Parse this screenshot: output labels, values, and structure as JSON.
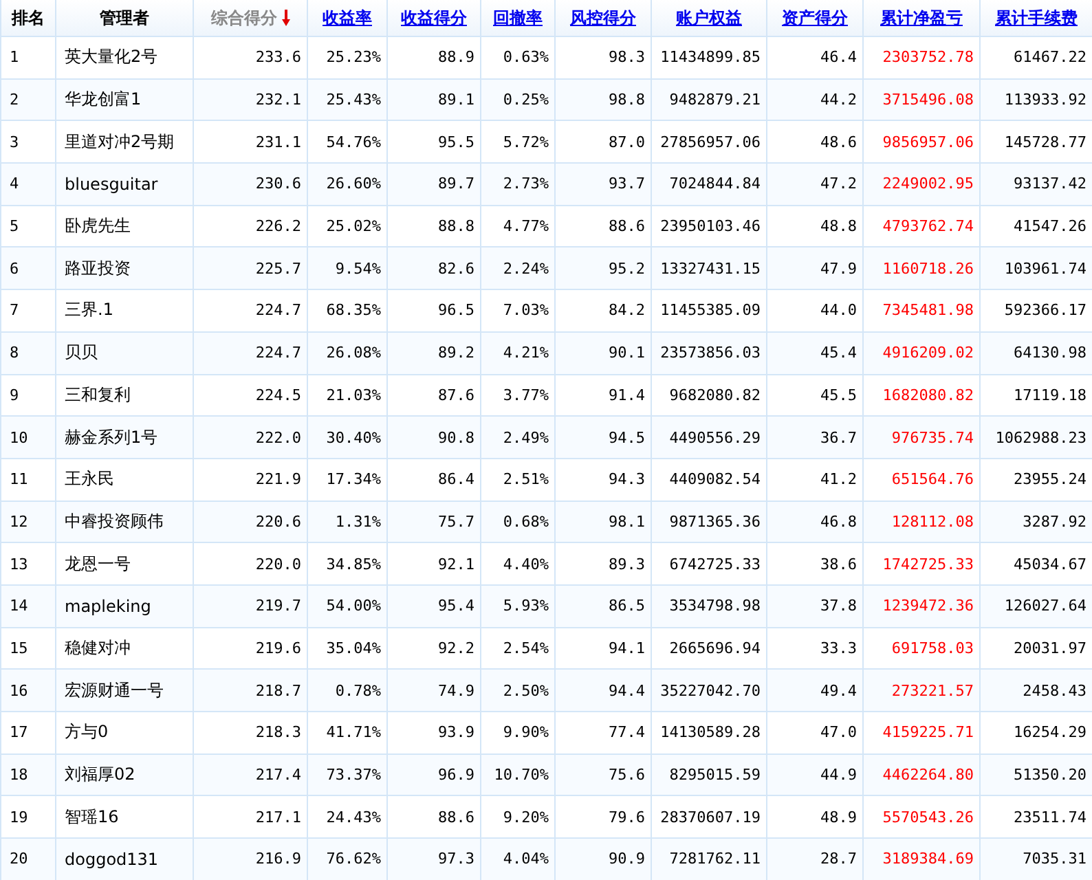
{
  "table": {
    "columns": [
      {
        "label": "排名",
        "kind": "plain",
        "sorted": false,
        "highlight": false
      },
      {
        "label": "管理者",
        "kind": "plain",
        "sorted": false,
        "highlight": false
      },
      {
        "label": "综合得分",
        "kind": "active",
        "sorted": true,
        "highlight": false
      },
      {
        "label": "收益率",
        "kind": "link",
        "sorted": false,
        "highlight": false
      },
      {
        "label": "收益得分",
        "kind": "link",
        "sorted": false,
        "highlight": false
      },
      {
        "label": "回撤率",
        "kind": "link",
        "sorted": false,
        "highlight": false
      },
      {
        "label": "风控得分",
        "kind": "link",
        "sorted": false,
        "highlight": false
      },
      {
        "label": "账户权益",
        "kind": "link",
        "sorted": false,
        "highlight": false
      },
      {
        "label": "资产得分",
        "kind": "link",
        "sorted": false,
        "highlight": false
      },
      {
        "label": "累计净盈亏",
        "kind": "link",
        "sorted": false,
        "highlight": true
      },
      {
        "label": "累计手续费",
        "kind": "link",
        "sorted": false,
        "highlight": false
      }
    ],
    "rows": [
      [
        "1",
        "英大量化2号",
        "233.6",
        "25.23%",
        "88.9",
        "0.63%",
        "98.3",
        "11434899.85",
        "46.4",
        "2303752.78",
        "61467.22"
      ],
      [
        "2",
        "华龙创富1",
        "232.1",
        "25.43%",
        "89.1",
        "0.25%",
        "98.8",
        "9482879.21",
        "44.2",
        "3715496.08",
        "113933.92"
      ],
      [
        "3",
        "里道对冲2号期",
        "231.1",
        "54.76%",
        "95.5",
        "5.72%",
        "87.0",
        "27856957.06",
        "48.6",
        "9856957.06",
        "145728.77"
      ],
      [
        "4",
        "bluesguitar",
        "230.6",
        "26.60%",
        "89.7",
        "2.73%",
        "93.7",
        "7024844.84",
        "47.2",
        "2249002.95",
        "93137.42"
      ],
      [
        "5",
        "卧虎先生",
        "226.2",
        "25.02%",
        "88.8",
        "4.77%",
        "88.6",
        "23950103.46",
        "48.8",
        "4793762.74",
        "41547.26"
      ],
      [
        "6",
        "路亚投资",
        "225.7",
        "9.54%",
        "82.6",
        "2.24%",
        "95.2",
        "13327431.15",
        "47.9",
        "1160718.26",
        "103961.74"
      ],
      [
        "7",
        "三界.1",
        "224.7",
        "68.35%",
        "96.5",
        "7.03%",
        "84.2",
        "11455385.09",
        "44.0",
        "7345481.98",
        "592366.17"
      ],
      [
        "8",
        "贝贝",
        "224.7",
        "26.08%",
        "89.2",
        "4.21%",
        "90.1",
        "23573856.03",
        "45.4",
        "4916209.02",
        "64130.98"
      ],
      [
        "9",
        "三和复利",
        "224.5",
        "21.03%",
        "87.6",
        "3.77%",
        "91.4",
        "9682080.82",
        "45.5",
        "1682080.82",
        "17119.18"
      ],
      [
        "10",
        "赫金系列1号",
        "222.0",
        "30.40%",
        "90.8",
        "2.49%",
        "94.5",
        "4490556.29",
        "36.7",
        "976735.74",
        "1062988.23"
      ],
      [
        "11",
        "王永民",
        "221.9",
        "17.34%",
        "86.4",
        "2.51%",
        "94.3",
        "4409082.54",
        "41.2",
        "651564.76",
        "23955.24"
      ],
      [
        "12",
        "中睿投资顾伟",
        "220.6",
        "1.31%",
        "75.7",
        "0.68%",
        "98.1",
        "9871365.36",
        "46.8",
        "128112.08",
        "3287.92"
      ],
      [
        "13",
        "龙恩一号",
        "220.0",
        "34.85%",
        "92.1",
        "4.40%",
        "89.3",
        "6742725.33",
        "38.6",
        "1742725.33",
        "45034.67"
      ],
      [
        "14",
        "mapleking",
        "219.7",
        "54.00%",
        "95.4",
        "5.93%",
        "86.5",
        "3534798.98",
        "37.8",
        "1239472.36",
        "126027.64"
      ],
      [
        "15",
        "稳健对冲",
        "219.6",
        "35.04%",
        "92.2",
        "2.54%",
        "94.1",
        "2665696.94",
        "33.3",
        "691758.03",
        "20031.97"
      ],
      [
        "16",
        "宏源财通一号",
        "218.7",
        "0.78%",
        "74.9",
        "2.50%",
        "94.4",
        "35227042.70",
        "49.4",
        "273221.57",
        "2458.43"
      ],
      [
        "17",
        "方与0",
        "218.3",
        "41.71%",
        "93.9",
        "9.90%",
        "77.4",
        "14130589.28",
        "47.0",
        "4159225.71",
        "16254.29"
      ],
      [
        "18",
        "刘福厚02",
        "217.4",
        "73.37%",
        "96.9",
        "10.70%",
        "75.6",
        "8295015.59",
        "44.9",
        "4462264.80",
        "51350.20"
      ],
      [
        "19",
        "智瑶16",
        "217.1",
        "24.43%",
        "88.6",
        "9.20%",
        "79.6",
        "28370607.19",
        "48.9",
        "5570543.26",
        "23511.74"
      ],
      [
        "20",
        "doggod131",
        "216.9",
        "76.62%",
        "97.3",
        "4.04%",
        "90.9",
        "7281762.11",
        "28.7",
        "3189384.69",
        "7035.31"
      ]
    ]
  }
}
